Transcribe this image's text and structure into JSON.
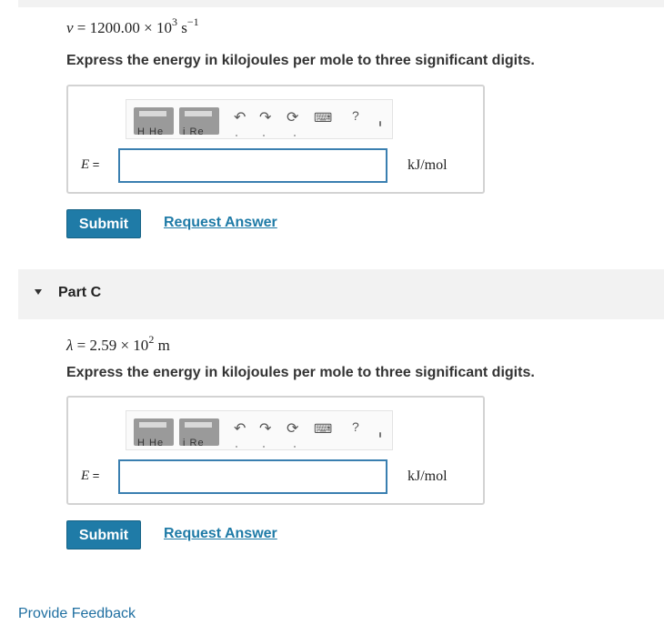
{
  "partB": {
    "given": {
      "symbol": "ν",
      "eq": " = 1200.00 × 10",
      "exp": "3",
      "unit": " s",
      "unit_exp": "−1"
    },
    "prompt": "Express the energy in kilojoules per mole to three significant digits.",
    "var_symbol": "E",
    "var_eq": " =",
    "answer_value": "",
    "unit": "kJ/mol",
    "submit_label": "Submit",
    "request_label": "Request Answer"
  },
  "partC": {
    "header": "Part C",
    "given": {
      "symbol": "λ",
      "eq": " = 2.59 × 10",
      "exp": "2",
      "unit": " m"
    },
    "prompt": "Express the energy in kilojoules per mole to three significant digits.",
    "var_symbol": "E",
    "var_eq": " =",
    "answer_value": "",
    "unit": "kJ/mol",
    "submit_label": "Submit",
    "request_label": "Request Answer"
  },
  "toolbar": {
    "template1_label": "H He",
    "template2_label": "i Re",
    "icons": [
      "undo-icon",
      "redo-icon",
      "reset-icon",
      "keyboard-icon",
      "help-icon"
    ],
    "glyphs": {
      "undo": "↶",
      "redo": "↷",
      "reset": "⟳",
      "keyboard": "⌨",
      "help": "?"
    }
  },
  "footer": {
    "feedback_label": "Provide Feedback"
  },
  "colors": {
    "accent": "#1f7ba7",
    "input_border": "#3a7fb0",
    "band": "#f2f2f2"
  }
}
